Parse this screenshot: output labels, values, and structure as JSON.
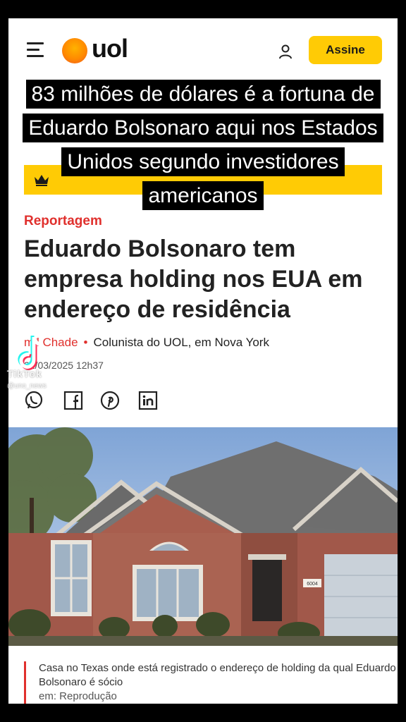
{
  "header": {
    "logo_text": "uol",
    "subscribe_label": "Assine"
  },
  "video_caption": "83 milhões de dólares é a fortuna de Eduardo Bolsonaro aqui nos Estados Unidos segundo investidores americanos",
  "article": {
    "kicker": "Reportagem",
    "headline": "Eduardo Bolsonaro tem empresa holding nos EUA em endereço de residência",
    "author": "mil Chade",
    "author_role": "Colunista do UOL, em Nova York",
    "date": "21/03/2025 12h37",
    "share_icons": [
      "whatsapp-icon",
      "facebook-icon",
      "pinterest-icon",
      "linkedin-icon"
    ],
    "photo_caption": "Casa no Texas onde está registrado o endereço de holding da qual Eduardo Bolsonaro é sócio",
    "photo_credit": "em: Reprodução",
    "house_number": "6004"
  },
  "watermark": {
    "app": "TikTok",
    "user": "@uno_news"
  },
  "colors": {
    "accent_red": "#e0302d",
    "brand_yellow": "#ffcb05"
  }
}
